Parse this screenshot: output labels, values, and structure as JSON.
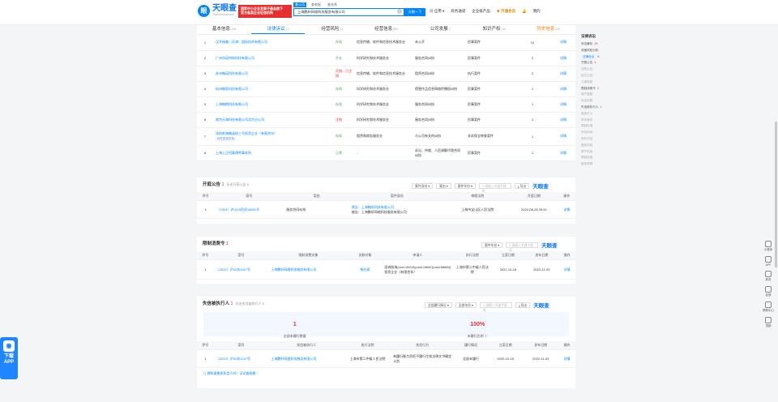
{
  "header": {
    "logo_name": "天眼查",
    "logo_url": "TianYanCha.com",
    "promo_line1": "国家中小企业发展子基金旗下",
    "promo_line2": "官方备案企业征信机构",
    "search_tabs": [
      "查公司",
      "查老板",
      "查关系"
    ],
    "search_value": "上海鹏轩网络科技服务有限公司",
    "search_button": "天眼一下",
    "nav": [
      "应用",
      "商务通道",
      "企业级产品",
      "开通会员",
      "我的"
    ]
  },
  "tabs": [
    {
      "label": "基本信息",
      "count": "138"
    },
    {
      "label": "法律诉讼",
      "count": "12"
    },
    {
      "label": "经营风险",
      "count": "11"
    },
    {
      "label": "经营信息",
      "count": "893"
    },
    {
      "label": "公司发展",
      "count": "4"
    },
    {
      "label": "知识产权",
      "count": "110"
    },
    {
      "label": "历史信息",
      "count": "144"
    }
  ],
  "lawsuits": {
    "rows": [
      {
        "idx": "1",
        "company": "汉华瑞美（天津）国际技术有限公司",
        "status": "存续",
        "industry": "信息传输、软件和信息技术服务业",
        "role": "未公开",
        "type": "民事案件",
        "count": "10",
        "action": "详情"
      },
      {
        "idx": "2",
        "company": "广州市因特网科技有限公司",
        "status": "开业",
        "industry": "科学研究和技术服务业",
        "role": "服务合同纠纷",
        "type": "民事案件",
        "count": "2",
        "action": "详情"
      },
      {
        "idx": "3",
        "company": "苏州翰诺科技有限公司",
        "status": "吊销，已注销",
        "industry": "信息传输、软件和信息技术服务业",
        "role": "租赁合同纠纷",
        "type": "执行案件",
        "count": "2",
        "action": "详情"
      },
      {
        "idx": "4",
        "company": "杭州翰思科技有限公司",
        "status": "存续",
        "industry": "科学研究和技术服务业",
        "role": "侵害作品信息网络传播权纠纷",
        "type": "民事案件",
        "count": "1",
        "action": "详情"
      },
      {
        "idx": "5",
        "company": "上海翰朗科技有限公司",
        "status": "存续",
        "industry": "科学研究和技术服务业",
        "role": "服务合同纠纷",
        "type": "民事案件",
        "count": "1",
        "action": "详情"
      },
      {
        "idx": "6",
        "company": "南京乐海科技有限公司北京分公司",
        "status": "注销",
        "industry": "科学研究和技术服务业",
        "role": "服务合同纠纷",
        "type": "民事案件",
        "count": "1",
        "action": "详情"
      },
      {
        "idx": "7",
        "company": "深圳前海翰涵创三号投资企业（有限合伙）",
        "tag": "存在投资关系",
        "status": "存续",
        "industry": "租赁和商务服务业",
        "role": "与公司有关的纠纷",
        "type": "非诉保全审查案件",
        "count": "1",
        "action": "详情"
      },
      {
        "idx": "8",
        "company": "上海上正恒泰律师事务所",
        "status": "正常",
        "industry": "-",
        "role": "诉讼、仲裁、人民调解代理合同纠纷",
        "type": "民事案件",
        "count": "1",
        "action": "详情"
      }
    ]
  },
  "court_notice": {
    "title": "开庭公告",
    "count": "1",
    "sub": "历史开庭公告 8",
    "tools": [
      "案件身份",
      "案由",
      "案件年份"
    ],
    "search_placeholder": "请输入关键字搜索",
    "export": "导出",
    "brand": "天眼查",
    "headers": [
      "序号",
      "案号",
      "案由",
      "案件身份",
      "审理法院",
      "开庭日期",
      "操作"
    ],
    "rows": [
      {
        "idx": "1",
        "case_no": "（2024）沪0115民初14891号",
        "reason": "服务合同纠纷",
        "party1": "原告：上海翰轩科技有限公司",
        "party2": "被告：上海鹏轩网络科技服务有限公司",
        "court": "上海市宝山区人民法院",
        "date": "2024-08-28 09:00",
        "action": "详情"
      }
    ]
  },
  "restriction": {
    "title": "限制消费令",
    "count": "1",
    "tools": [
      "案件年份"
    ],
    "search_placeholder": "请输入关键字搜索",
    "export": "导出",
    "brand": "天眼查",
    "headers": [
      "序号",
      "案号",
      "限制消费对象",
      "关联对象",
      "申请人",
      "执行法院",
      "立案日期",
      "发布日期",
      "操作"
    ],
    "rows": [
      {
        "idx": "1",
        "case_no": "（2022）沪02执1047号",
        "target": "上海鹏轩网络科技服务有限公司",
        "related": "杨杜斌",
        "applicant": "深圳前海(cxid:19200)(cxid:19667)(cxid:58884)投资企业（有限合伙）",
        "court": "上海市第二中级人民法院",
        "file_date": "2022-10-18",
        "pub_date": "2022-11-03",
        "action": "详情"
      }
    ]
  },
  "dishonest": {
    "title": "失信被执行人",
    "count": "1",
    "sub": "历史失信被执行人 2",
    "tools": [
      "全部履行情况",
      "全部年份"
    ],
    "search_placeholder": "请输入关键字搜索",
    "export": "导出",
    "brand": "天眼查",
    "summary": [
      {
        "value": "1",
        "label": "全部未履行数量",
        "color": "#e5302f"
      },
      {
        "value": "100%",
        "label": "未履行比例",
        "color": "#e5302f"
      }
    ],
    "headers": [
      "序号",
      "案号",
      "失信被执行人",
      "执行法院",
      "失信行为",
      "履行情况",
      "立案日期",
      "发布日期",
      "操作"
    ],
    "rows": [
      {
        "idx": "1",
        "case_no": "（2022）沪02执1047号",
        "name": "上海鹏轩网络科技服务有限公司",
        "court": "上海市第二中级人民法院",
        "behavior": "有履行能力而拒不履行生效法律文书确定义务",
        "status": "全部未履行",
        "file_date": "2022-10-18",
        "pub_date": "2022-11-03",
        "action": "详情"
      }
    ],
    "footer_link": "想知道更多失信人吗？试试查老赖"
  },
  "side_panel": {
    "title": "法律诉讼",
    "items": [
      {
        "label": "司法解析",
        "n": "25",
        "on": true
      },
      {
        "label": "深度风险分析",
        "n": "",
        "on": true
      },
      {
        "label": "法律诉讼",
        "n": "8",
        "sel": true
      },
      {
        "label": "开庭公告",
        "n": "1",
        "on": true
      },
      {
        "label": "法院公告",
        "n": "",
        "on": false
      },
      {
        "label": "送达公告",
        "n": "",
        "on": false
      },
      {
        "label": "立案信息",
        "n": "",
        "on": false
      },
      {
        "label": "限制消费令",
        "n": "1",
        "on": true
      },
      {
        "label": "破产重整",
        "n": "",
        "on": false
      },
      {
        "label": "司法协助",
        "n": "",
        "on": false
      },
      {
        "label": "失信被执行人",
        "n": "1",
        "on": true
      },
      {
        "label": "被执行人",
        "n": "",
        "on": false
      },
      {
        "label": "终本案件",
        "n": "",
        "on": false
      },
      {
        "label": "限制出境",
        "n": "",
        "on": false
      },
      {
        "label": "司法拍卖",
        "n": "",
        "on": false
      },
      {
        "label": "询价评估",
        "n": "",
        "on": false
      },
      {
        "label": "股权冻结",
        "n": "",
        "on": false
      },
      {
        "label": "资产拍卖",
        "n": "",
        "on": false
      },
      {
        "label": "限制出境",
        "n": "",
        "on": false
      },
      {
        "label": "股权质押",
        "n": "",
        "on": false
      }
    ]
  },
  "right_bar": [
    "小程序",
    "APP",
    "商务",
    "反馈",
    "帮助中心",
    "顶部"
  ],
  "app_float": {
    "line1": "下载",
    "line2": "APP"
  }
}
